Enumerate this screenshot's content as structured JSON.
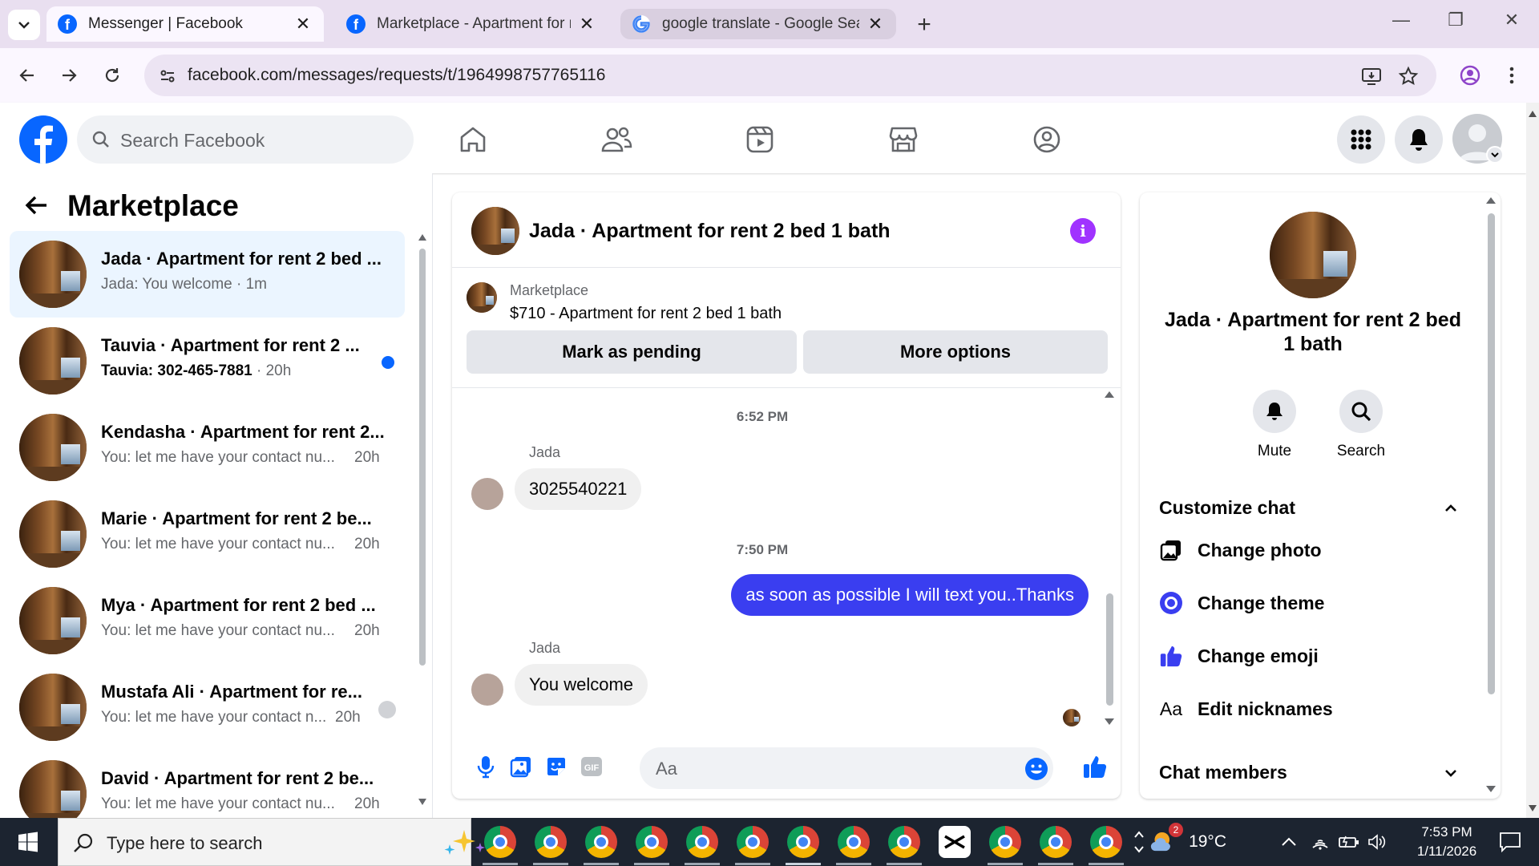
{
  "browser": {
    "tabs": [
      {
        "title": "Messenger | Facebook",
        "favicon": "facebook-icon"
      },
      {
        "title": "Marketplace - Apartment for re",
        "favicon": "facebook-icon"
      },
      {
        "title": "google translate - Google Searc",
        "favicon": "google-icon"
      }
    ],
    "url": "facebook.com/messages/requests/t/1964998757765116"
  },
  "fb": {
    "search_placeholder": "Search Facebook",
    "logo_letter": "f",
    "brand_color": "#0866ff"
  },
  "left": {
    "title": "Marketplace",
    "conversations": [
      {
        "name": "Jada · Apartment for rent 2 bed ...",
        "preview": "Jada: You welcome · 1m",
        "time": "",
        "active": true
      },
      {
        "name": "Tauvia · Apartment for rent 2 ...",
        "preview": "Tauvia: 302-465-7881",
        "time": "· 20h",
        "unread": true
      },
      {
        "name": "Kendasha · Apartment for rent 2...",
        "preview": "You: let me have your contact nu...",
        "time": "20h"
      },
      {
        "name": "Marie · Apartment for rent 2 be...",
        "preview": "You: let me have your contact nu...",
        "time": "20h"
      },
      {
        "name": "Mya · Apartment for rent 2 bed ...",
        "preview": "You: let me have your contact nu...",
        "time": "20h"
      },
      {
        "name": "Mustafa Ali · Apartment for re...",
        "preview": "You: let me have your contact n...",
        "time": "20h"
      },
      {
        "name": "David · Apartment for rent 2 be...",
        "preview": "You: let me have your contact nu...",
        "time": "20h"
      }
    ]
  },
  "chat": {
    "title": "Jada · Apartment for rent 2 bed 1 bath",
    "info_icon": "i",
    "listing": {
      "category": "Marketplace",
      "title": "$710 - Apartment for rent 2 bed 1 bath",
      "btn_pending": "Mark as pending",
      "btn_more": "More options"
    },
    "messages": [
      {
        "kind": "time",
        "text": "6:52 PM"
      },
      {
        "kind": "in",
        "sender": "Jada",
        "text": "3025540221"
      },
      {
        "kind": "time",
        "text": "7:50 PM"
      },
      {
        "kind": "out",
        "text": "as soon as possible I will text you..Thanks"
      },
      {
        "kind": "in",
        "sender": "Jada",
        "text": "You welcome"
      }
    ],
    "composer_placeholder": "Aa",
    "accent": "#3a3ef0"
  },
  "info": {
    "title": "Jada · Apartment for rent 2 bed 1 bath",
    "actions": [
      {
        "label": "Mute"
      },
      {
        "label": "Search"
      }
    ],
    "customize_label": "Customize chat",
    "options": [
      "Change photo",
      "Change theme",
      "Change emoji",
      "Edit nicknames"
    ],
    "nickname_glyph": "Aa",
    "members_label": "Chat members"
  },
  "taskbar": {
    "search_placeholder": "Type here to search",
    "weather": "19°C",
    "weather_badge": "2",
    "time": "7:53 PM",
    "date": "1/11/2026",
    "capcut_label": "CapCut"
  }
}
